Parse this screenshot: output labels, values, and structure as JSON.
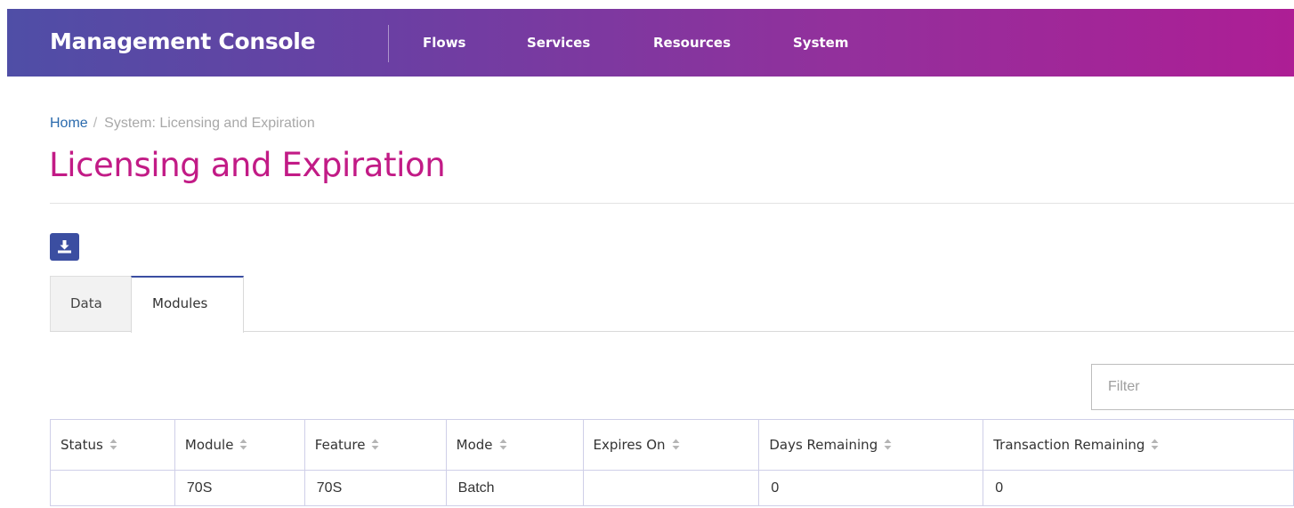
{
  "header": {
    "brand": "Management Console",
    "nav": [
      "Flows",
      "Services",
      "Resources",
      "System"
    ]
  },
  "breadcrumb": {
    "home": "Home",
    "separator": "/",
    "current": "System: Licensing and Expiration"
  },
  "page": {
    "title": "Licensing and Expiration"
  },
  "toolbar": {
    "download_icon": "download-icon"
  },
  "tabs": [
    "Data",
    "Modules"
  ],
  "active_tab": "Modules",
  "filter": {
    "placeholder": "Filter",
    "value": ""
  },
  "table": {
    "columns": [
      "Status",
      "Module",
      "Feature",
      "Mode",
      "Expires On",
      "Days Remaining",
      "Transaction Remaining"
    ],
    "rows": [
      [
        "",
        "70S",
        "70S",
        "Batch",
        "",
        "0",
        "0"
      ]
    ]
  },
  "colors": {
    "accent_title": "#c21b86",
    "primary_button": "#3b4ea1",
    "link": "#2a6aad",
    "header_gradient_start": "#4f4ea6",
    "header_gradient_end": "#ad1e95"
  }
}
